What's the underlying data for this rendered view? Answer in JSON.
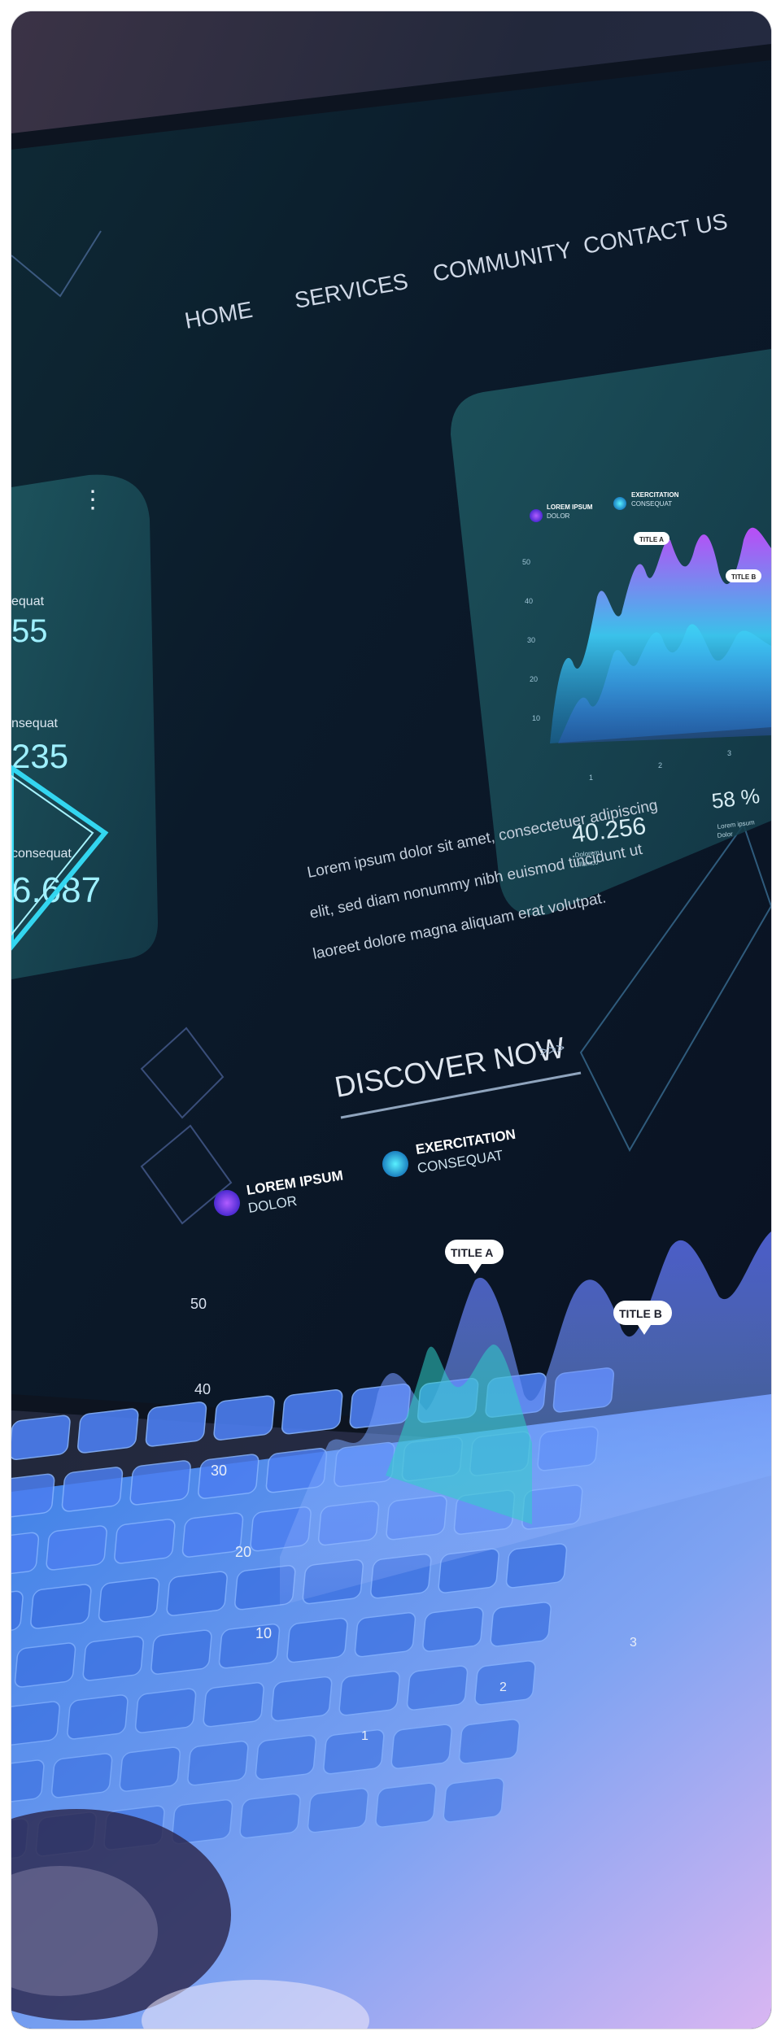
{
  "nav": {
    "items": [
      "HOME",
      "SERVICES",
      "COMMUNITY",
      "CONTACT US"
    ]
  },
  "left_panel": {
    "labels": [
      "equat",
      "nsequat",
      "consequat"
    ],
    "values": [
      "55",
      "235",
      "6.687"
    ]
  },
  "small_chart": {
    "legend": [
      {
        "title": "LOREM IPSUM",
        "sub": "DOLOR"
      },
      {
        "title": "EXERCITATION",
        "sub": "CONSEQUAT"
      }
    ],
    "callouts": [
      "TITLE A",
      "TITLE B"
    ],
    "y_ticks": [
      "50",
      "40",
      "30",
      "20",
      "10"
    ],
    "x_ticks": [
      "1",
      "2",
      "3"
    ],
    "stat_value": "40.256",
    "stat_caption_1": "Dolorem",
    "stat_caption_2": "Ullamco",
    "percent": "58 %",
    "percent_caption_1": "Lorem ipsum",
    "percent_caption_2": "Dolor"
  },
  "body_text": {
    "lines": [
      "Lorem ipsum dolor sit amet, consectetuer adipiscing",
      "elit, sed diam nonummy nibh euismod tincidunt ut",
      "laoreet dolore magna aliquam erat volutpat."
    ]
  },
  "cta": {
    "label": "DISCOVER NOW",
    "arrows": ">>>"
  },
  "big_chart": {
    "legend": [
      {
        "title": "LOREM IPSUM",
        "sub": "DOLOR"
      },
      {
        "title": "EXERCITATION",
        "sub": "CONSEQUAT"
      }
    ],
    "callouts": [
      "TITLE A",
      "TITLE B"
    ],
    "y_ticks": [
      "50",
      "40",
      "30",
      "20",
      "10"
    ],
    "x_ticks": [
      "1",
      "2",
      "3"
    ]
  },
  "colors": {
    "accent_cyan": "#33d6f0",
    "accent_purple": "#a34dff",
    "keyboard_blue": "#3e8df5",
    "screen_bg": "#0d1b2a"
  }
}
